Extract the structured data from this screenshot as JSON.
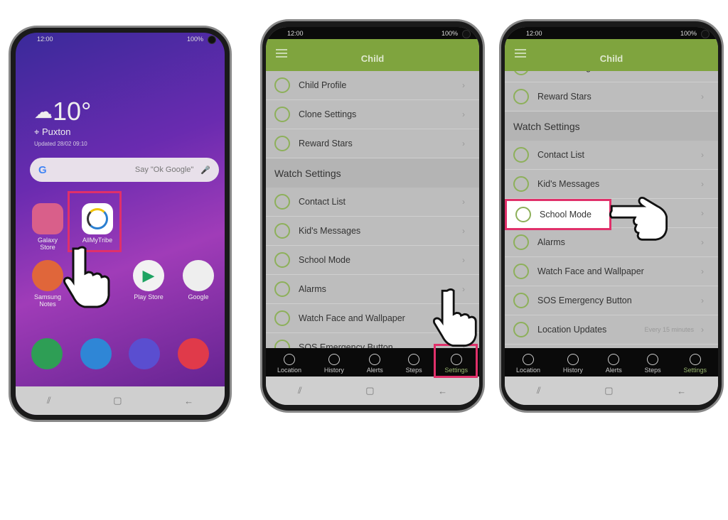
{
  "phone1": {
    "status": {
      "time": "12:00",
      "battery": "100%"
    },
    "weather": {
      "temp": "10°",
      "location": "Puxton",
      "updated": "Updated 28/02 09:10"
    },
    "search": {
      "placeholder": "Say \"Ok Google\""
    },
    "apps": [
      {
        "label": "Galaxy Store",
        "color": "#d95f8a"
      },
      {
        "label": "AllMyTribe",
        "color": "#ffffff"
      },
      {
        "label": "Samsung Notes",
        "color": "#e0663a"
      },
      {
        "label": "",
        "color": "#d44"
      },
      {
        "label": "Play Store",
        "color": "#f2f2f2"
      },
      {
        "label": "Google",
        "color": "#eeeeee"
      }
    ],
    "dock": [
      {
        "name": "phone",
        "color": "#2e9e55"
      },
      {
        "name": "messages",
        "color": "#2f86d6"
      },
      {
        "name": "internet",
        "color": "#5a4ed0"
      },
      {
        "name": "camera",
        "color": "#e03a4a"
      }
    ]
  },
  "app_screen": {
    "status": {
      "time": "12:00",
      "battery": "100%"
    },
    "title": "Child",
    "items": {
      "child_profile": "Child Profile",
      "clone_settings": "Clone Settings",
      "reward_stars": "Reward Stars",
      "watch_settings": "Watch Settings",
      "contact_list": "Contact List",
      "kids_messages": "Kid's Messages",
      "school_mode": "School Mode",
      "alarms": "Alarms",
      "watch_face": "Watch Face and Wallpaper",
      "sos": "SOS Emergency Button",
      "location_updates": "Location Updates",
      "location_updates_value": "Every 15 minutes"
    },
    "tabs": [
      "Location",
      "History",
      "Alerts",
      "Steps",
      "Settings"
    ],
    "active_tab": "Settings"
  },
  "colors": {
    "accent": "#7fa43e",
    "highlight": "#e0306a"
  }
}
